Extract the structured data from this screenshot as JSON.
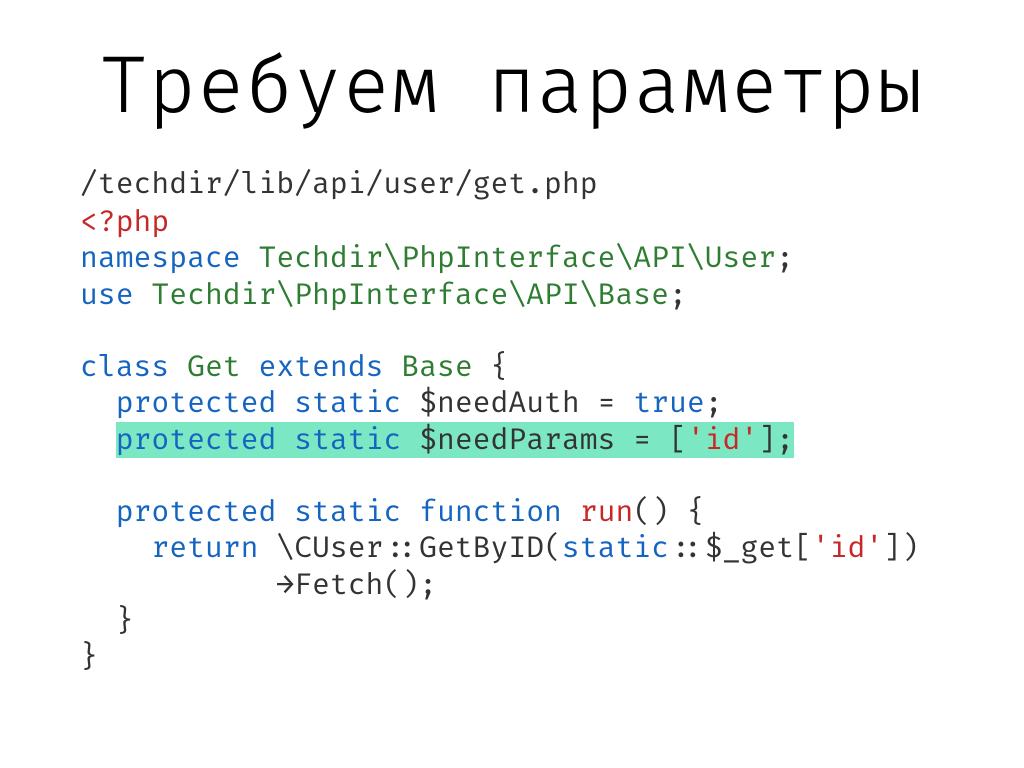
{
  "title": "Требуем параметры",
  "filepath": "/techdir/lib/api/user/get.php",
  "code": {
    "php_open": "<?php",
    "ns_kw": "namespace",
    "ns_name": "Techdir\\PhpInterface\\API\\User",
    "use_kw": "use",
    "use_name": "Techdir\\PhpInterface\\API\\Base",
    "class_kw": "class",
    "class_name": "Get",
    "extends_kw": "extends",
    "base_name": "Base",
    "prot_kw": "protected",
    "static_kw": "static",
    "needAuth_var": "$needAuth",
    "true_kw": "true",
    "needParams_var": "$needParams",
    "id_str": "'id'",
    "function_kw": "function",
    "run_fn": "run",
    "return_kw": "return",
    "cuser": "\\CUser",
    "getbyid": "GetByID",
    "static_ref": "static",
    "get_var": "$_get",
    "fetch": "Fetch"
  }
}
